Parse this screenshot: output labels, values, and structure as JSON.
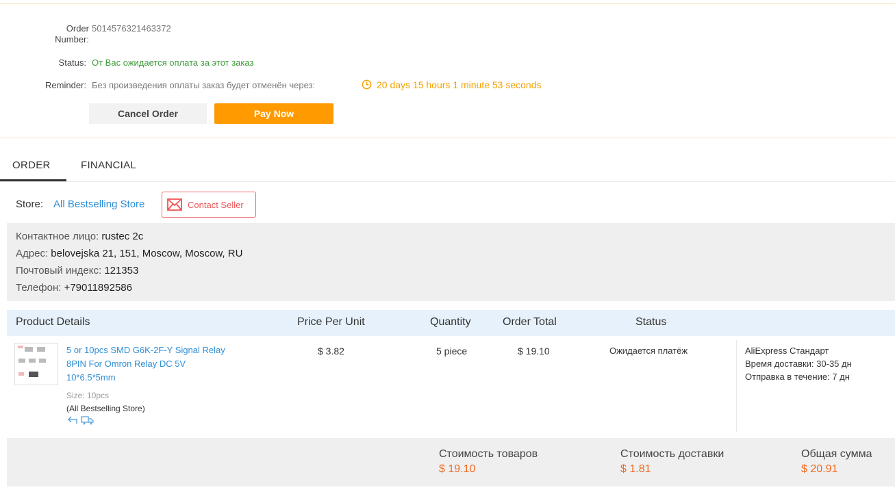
{
  "order": {
    "number_label_1": "Order",
    "number_label_2": "Number:",
    "number": "5014576321463372",
    "status_label": "Status:",
    "status": "От Вас ожидается оплата за этот заказ",
    "reminder_label": "Reminder:",
    "reminder_text": "Без произведения оплаты заказ будет отменён через:",
    "countdown": "20 days 15 hours 1 minute 53 seconds",
    "cancel_label": "Cancel Order",
    "pay_label": "Pay Now"
  },
  "tabs": [
    {
      "label": "ORDER",
      "active": true
    },
    {
      "label": "FINANCIAL",
      "active": false
    }
  ],
  "store": {
    "label": "Store:",
    "name": "All Bestselling Store",
    "contact_label": "Contact Seller"
  },
  "address": {
    "contact_label": "Контактное лицо:",
    "contact": "rustec 2c",
    "addr_label": "Адрес:",
    "addr": "belovejska 21, 151, Moscow, Moscow, RU",
    "zip_label": "Почтовый индекс:",
    "zip": "121353",
    "phone_label": "Телефон:",
    "phone": "+79011892586"
  },
  "table": {
    "headers": [
      "Product Details",
      "Price Per Unit",
      "Quantity",
      "Order Total",
      "Status"
    ],
    "row": {
      "title_1": "5 or 10pcs SMD G6K-2F-Y Signal Relay",
      "title_2": "8PIN For Omron Relay DC 5V",
      "title_3": "10*6.5*5mm",
      "size": "Size: 10pcs",
      "store": "(All Bestselling Store)",
      "price": "$ 3.82",
      "quantity": "5 piece",
      "total": "$ 19.10",
      "status": "Ожидается платёж",
      "ship_1": "AliExpress Стандарт",
      "ship_2": "Время доставки: 30-35 дн",
      "ship_3": "Отправка в течение: 7 дн"
    }
  },
  "totals": {
    "goods_label": "Стоимость товаров",
    "goods": "$ 19.10",
    "shipping_label": "Стоимость доставки",
    "shipping": "$ 1.81",
    "total_label": "Общая сумма",
    "total": "$ 20.91"
  },
  "colors": {
    "accent_orange": "#ff9a00",
    "link_blue": "#2e8fd6",
    "status_green": "#3f9b3b",
    "price_orange": "#f06a22"
  },
  "icons": [
    "clock-icon",
    "mail-icon",
    "return-icon",
    "truck-icon"
  ]
}
